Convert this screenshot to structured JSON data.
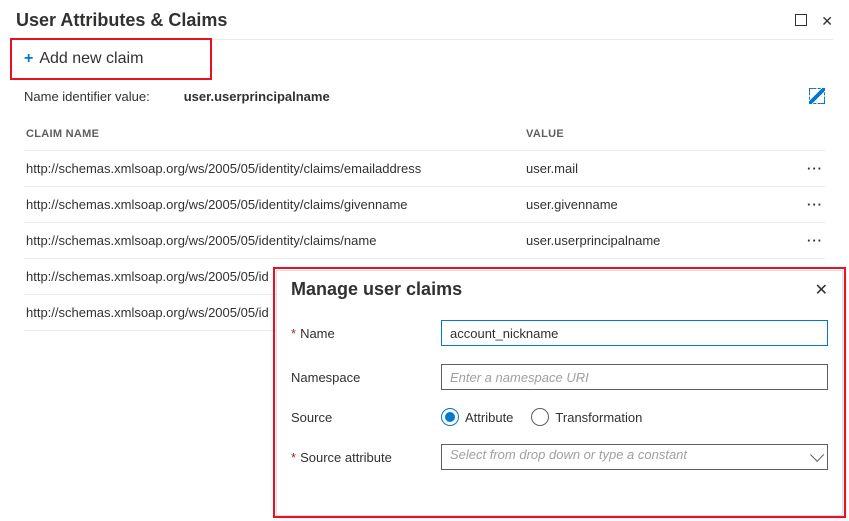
{
  "header": {
    "title": "User Attributes & Claims"
  },
  "toolbar": {
    "add_new_claim": "Add new claim"
  },
  "name_identifier": {
    "label": "Name identifier value:",
    "value": "user.userprincipalname"
  },
  "table": {
    "headers": {
      "claim_name": "Claim Name",
      "value": "Value"
    },
    "rows": [
      {
        "name": "http://schemas.xmlsoap.org/ws/2005/05/identity/claims/emailaddress",
        "value": "user.mail"
      },
      {
        "name": "http://schemas.xmlsoap.org/ws/2005/05/identity/claims/givenname",
        "value": "user.givenname"
      },
      {
        "name": "http://schemas.xmlsoap.org/ws/2005/05/identity/claims/name",
        "value": "user.userprincipalname"
      },
      {
        "name": "http://schemas.xmlsoap.org/ws/2005/05/id",
        "value": ""
      },
      {
        "name": "http://schemas.xmlsoap.org/ws/2005/05/id",
        "value": ""
      }
    ]
  },
  "panel": {
    "title": "Manage user claims",
    "fields": {
      "name_label": "Name",
      "name_value": "account_nickname",
      "namespace_label": "Namespace",
      "namespace_placeholder": "Enter a namespace URI",
      "source_label": "Source",
      "source_option_attribute": "Attribute",
      "source_option_transformation": "Transformation",
      "source_selected": "attribute",
      "source_attribute_label": "Source attribute",
      "source_attribute_placeholder": "Select from drop down or type a constant"
    }
  }
}
